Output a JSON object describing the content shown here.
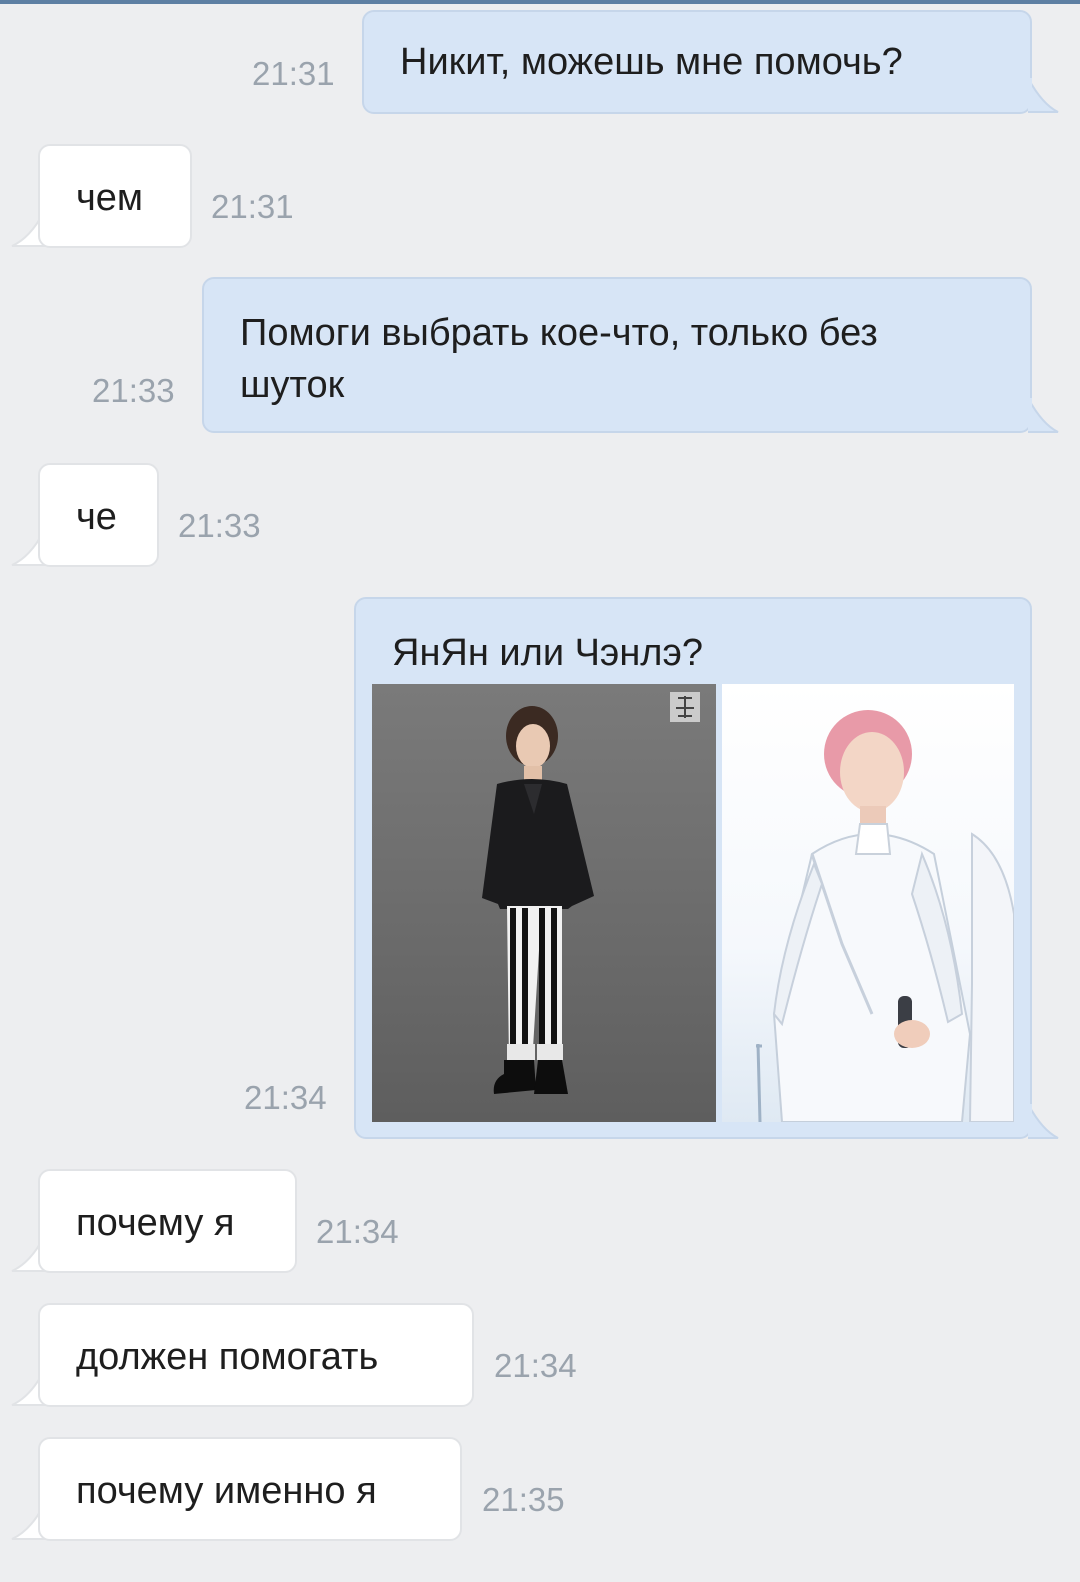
{
  "messages": [
    {
      "side": "out",
      "text": "Никит, можешь мне помочь?",
      "time": "21:31"
    },
    {
      "side": "in",
      "text": "чем",
      "time": "21:31"
    },
    {
      "side": "out",
      "text_lines": [
        "Помоги выбрать кое-что, только без",
        "шуток"
      ],
      "time": "21:33"
    },
    {
      "side": "in",
      "text": "че",
      "time": "21:33"
    },
    {
      "side": "out",
      "text": "ЯнЯн или Чэнлэ?",
      "time": "21:34",
      "attachments": [
        "photo-left",
        "photo-right"
      ]
    },
    {
      "side": "in",
      "text": "почему я",
      "time": "21:34"
    },
    {
      "side": "in",
      "text": "должен помогать",
      "time": "21:34"
    },
    {
      "side": "in",
      "text": "почему именно я",
      "time": "21:35"
    }
  ],
  "colors": {
    "background": "#edeef0",
    "outgoing_bubble": "#d7e5f6",
    "incoming_bubble": "#ffffff",
    "time": "#9aa3ad",
    "text": "#1e1e1e"
  }
}
